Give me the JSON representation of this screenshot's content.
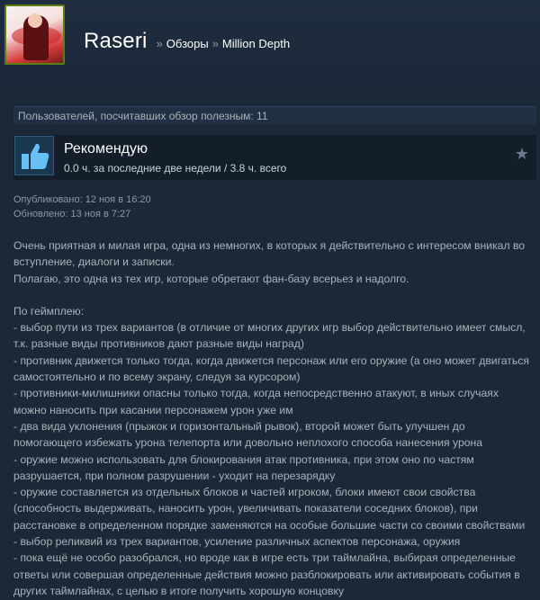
{
  "header": {
    "persona_name": "Raseri",
    "separator": "»",
    "breadcrumb_1": "Обзоры",
    "breadcrumb_2": "Million Depth"
  },
  "helpful": "Пользователей, посчитавших обзор полезным: 11",
  "recommendation": {
    "title": "Рекомендую",
    "hours": "0.0 ч. за последние две недели / 3.8 ч. всего"
  },
  "dates": {
    "posted": "Опубликовано: 12 ноя в 16:20",
    "updated": "Обновлено: 13 ноя в 7:27"
  },
  "review": {
    "intro_1": "Очень приятная и милая игра, одна из немногих, в которых я действительно с интересом вникал во вступление, диалоги и записки.",
    "intro_2": "Полагаю, это одна из тех игр, которые обретают фан-базу всерьез и надолго.",
    "gameplay_header": "По геймплею:",
    "items": [
      "- выбор пути из трех вариантов (в отличие от многих других игр выбор действительно имеет смысл, т.к. разные виды противников дают разные виды наград)",
      "- противник движется только тогда, когда движется персонаж или его оружие (а оно может двигаться самостоятельно и по всему экрану, следуя за курсором)",
      "- противники-милишники опасны только тогда, когда непосредственно атакуют, в иных случаях можно наносить при касании персонажем урон уже им",
      "- два вида уклонения (прыжок и горизонтальный рывок), второй может быть улучшен до помогающего избежать урона телепорта или довольно неплохого способа нанесения урона",
      "- оружие можно использовать для блокирования атак противника, при этом оно по частям разрушается, при полном разрушении - уходит на перезарядку",
      "- оружие составляется из отдельных блоков и частей игроком, блоки имеют свои свойства (способность выдерживать, наносить урон, увеличивать показатели соседних блоков), при расстановке в определенном порядке заменяются на особые большие части со своими свойствами",
      "- выбор реликвий из трех вариантов, усиление различных аспектов персонажа, оружия",
      "- пока ещё не особо разобрался, но вроде как в игре есть три таймлайна, выбирая определенные ответы или совершая определенные действия можно разблокировать или активировать события в других таймлайнах, с целью в итоге получить хорошую концовку"
    ]
  },
  "icons": {
    "thumb": "thumbs-up-icon",
    "star": "star-icon"
  },
  "colors": {
    "background": "#1b2838",
    "thumb_blue": "#66c0f4",
    "avatar_border": "#5c7e10"
  }
}
